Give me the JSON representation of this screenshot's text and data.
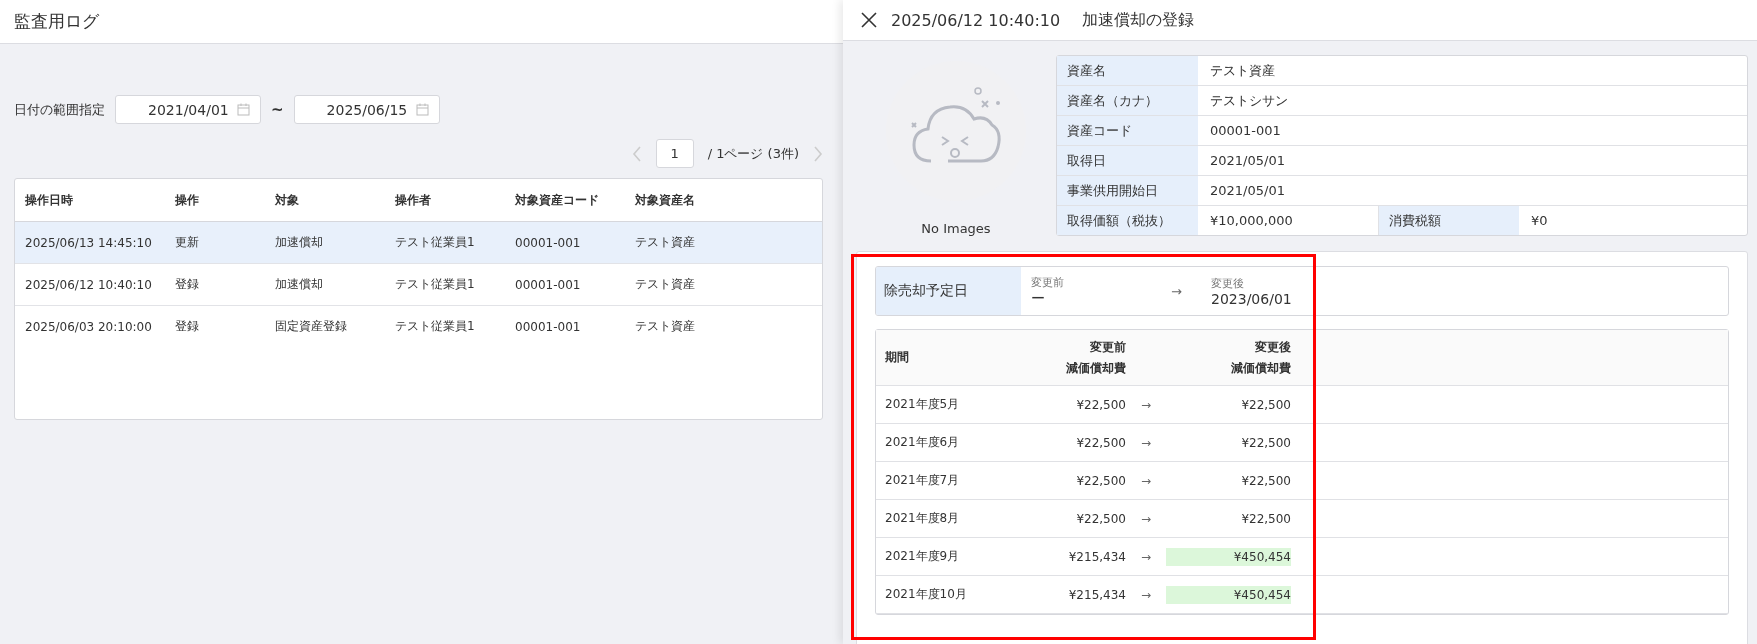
{
  "page": {
    "title": "監査用ログ"
  },
  "filter": {
    "label": "日付の範囲指定",
    "from": "2021/04/01",
    "separator": "~",
    "to": "2025/06/15"
  },
  "pagination": {
    "page": "1",
    "info": "/ 1ページ (3件)"
  },
  "log_table": {
    "columns": [
      "操作日時",
      "操作",
      "対象",
      "操作者",
      "対象資産コード",
      "対象資産名"
    ],
    "rows": [
      {
        "cells": [
          "2025/06/13 14:45:10",
          "更新",
          "加速償却",
          "テスト従業員1",
          "00001-001",
          "テスト資産"
        ],
        "selected": true
      },
      {
        "cells": [
          "2025/06/12 10:40:10",
          "登録",
          "加速償却",
          "テスト従業員1",
          "00001-001",
          "テスト資産"
        ],
        "selected": false
      },
      {
        "cells": [
          "2025/06/03 20:10:00",
          "登録",
          "固定資産登録",
          "テスト従業員1",
          "00001-001",
          "テスト資産"
        ],
        "selected": false
      }
    ]
  },
  "detail": {
    "title_time": "2025/06/12 10:40:10",
    "title_action": "加速償却の登録",
    "no_image_label": "No Images",
    "info": [
      {
        "label": "資産名",
        "value": "テスト資産"
      },
      {
        "label": "資産名（カナ）",
        "value": "テストシサン"
      },
      {
        "label": "資産コード",
        "value": "00001-001"
      },
      {
        "label": "取得日",
        "value": "2021/05/01"
      },
      {
        "label": "事業供用開始日",
        "value": "2021/05/01"
      },
      {
        "label": "取得価額（税抜）",
        "value": "¥10,000,000",
        "extra_label": "消費税額",
        "extra_value": "¥0"
      }
    ],
    "change": {
      "label": "除売却予定日",
      "before_label": "変更前",
      "before": "ー",
      "arrow": "→",
      "after_label": "変更後",
      "after": "2023/06/01"
    },
    "schedule": {
      "columns": [
        {
          "top": "期間"
        },
        {
          "top": "変更前",
          "bottom": "減価償却費"
        },
        {
          "top": "変更後",
          "bottom": "減価償却費"
        }
      ],
      "rows": [
        {
          "period": "2021年度5月",
          "before": "¥22,500",
          "arrow": "→",
          "after": "¥22,500",
          "changed": false
        },
        {
          "period": "2021年度6月",
          "before": "¥22,500",
          "arrow": "→",
          "after": "¥22,500",
          "changed": false
        },
        {
          "period": "2021年度7月",
          "before": "¥22,500",
          "arrow": "→",
          "after": "¥22,500",
          "changed": false
        },
        {
          "period": "2021年度8月",
          "before": "¥22,500",
          "arrow": "→",
          "after": "¥22,500",
          "changed": false
        },
        {
          "period": "2021年度9月",
          "before": "¥215,434",
          "arrow": "→",
          "after": "¥450,454",
          "changed": true
        },
        {
          "period": "2021年度10月",
          "before": "¥215,434",
          "arrow": "→",
          "after": "¥450,454",
          "changed": true
        }
      ]
    }
  }
}
